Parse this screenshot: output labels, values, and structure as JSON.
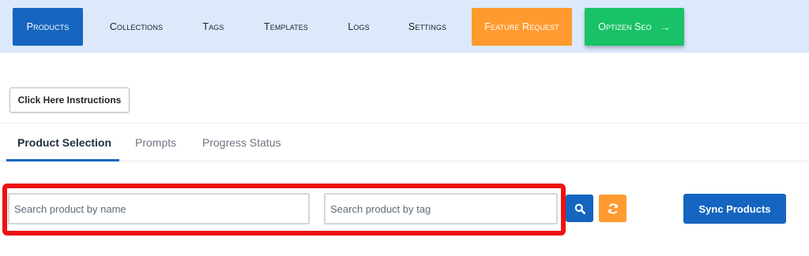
{
  "nav": {
    "items": [
      {
        "label": "Products"
      },
      {
        "label": "Collections"
      },
      {
        "label": "Tags"
      },
      {
        "label": "Templates"
      },
      {
        "label": "Logs"
      },
      {
        "label": "Settings"
      },
      {
        "label": "Feature Request"
      },
      {
        "label": "Optizen Seo",
        "icon": "arrow-right-icon"
      }
    ],
    "active_color": "#1565c0",
    "feature_color": "#ff9a2e",
    "seo_color": "#19c266"
  },
  "instructions_button": {
    "label": "Click Here Instructions"
  },
  "tabs": [
    {
      "label": "Product Selection",
      "active": true
    },
    {
      "label": "Prompts"
    },
    {
      "label": "Progress Status"
    }
  ],
  "search": {
    "name_placeholder": "Search product by name",
    "tag_placeholder": "Search product by tag",
    "search_icon": "search-icon",
    "refresh_icon": "refresh-icon"
  },
  "sync_button": {
    "label": "Sync Products"
  },
  "highlight_color": "#ee1111"
}
